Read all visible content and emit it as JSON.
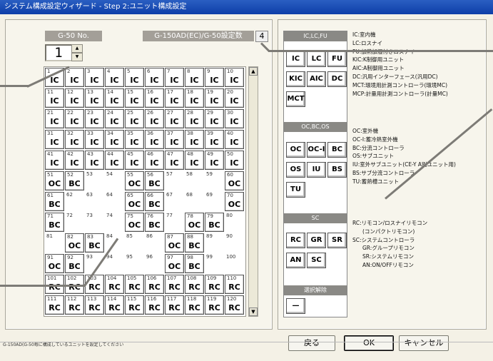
{
  "window": {
    "title": "システム構成設定ウィザード - Step 2:ユニット構成設定"
  },
  "left": {
    "g50_label": "G-50 No.",
    "g50_value": "1",
    "count_label": "G-150AD(EC)/G-50設定数",
    "count_value": "4"
  },
  "grid": {
    "cells": [
      {
        "n": "1",
        "c": "IC"
      },
      {
        "n": "2",
        "c": "IC"
      },
      {
        "n": "3",
        "c": "IC"
      },
      {
        "n": "4",
        "c": "IC"
      },
      {
        "n": "5",
        "c": "IC"
      },
      {
        "n": "6",
        "c": "IC"
      },
      {
        "n": "7",
        "c": "IC"
      },
      {
        "n": "8",
        "c": "IC"
      },
      {
        "n": "9",
        "c": "IC"
      },
      {
        "n": "10",
        "c": "IC"
      },
      {
        "n": "11",
        "c": "IC"
      },
      {
        "n": "12",
        "c": "IC"
      },
      {
        "n": "13",
        "c": "IC"
      },
      {
        "n": "14",
        "c": "IC"
      },
      {
        "n": "15",
        "c": "IC"
      },
      {
        "n": "16",
        "c": "IC"
      },
      {
        "n": "17",
        "c": "IC"
      },
      {
        "n": "18",
        "c": "IC"
      },
      {
        "n": "19",
        "c": "IC"
      },
      {
        "n": "20",
        "c": "IC"
      },
      {
        "n": "21",
        "c": "IC"
      },
      {
        "n": "22",
        "c": "IC"
      },
      {
        "n": "23",
        "c": "IC"
      },
      {
        "n": "24",
        "c": "IC"
      },
      {
        "n": "25",
        "c": "IC"
      },
      {
        "n": "26",
        "c": "IC"
      },
      {
        "n": "27",
        "c": "IC"
      },
      {
        "n": "28",
        "c": "IC"
      },
      {
        "n": "29",
        "c": "IC"
      },
      {
        "n": "30",
        "c": "IC"
      },
      {
        "n": "31",
        "c": "IC"
      },
      {
        "n": "32",
        "c": "IC"
      },
      {
        "n": "33",
        "c": "IC"
      },
      {
        "n": "34",
        "c": "IC"
      },
      {
        "n": "35",
        "c": "IC"
      },
      {
        "n": "36",
        "c": "IC"
      },
      {
        "n": "37",
        "c": "IC"
      },
      {
        "n": "38",
        "c": "IC"
      },
      {
        "n": "39",
        "c": "IC"
      },
      {
        "n": "40",
        "c": "IC"
      },
      {
        "n": "41",
        "c": "IC"
      },
      {
        "n": "42",
        "c": "IC"
      },
      {
        "n": "43",
        "c": "IC"
      },
      {
        "n": "44",
        "c": "IC"
      },
      {
        "n": "45",
        "c": "IC"
      },
      {
        "n": "46",
        "c": "IC"
      },
      {
        "n": "47",
        "c": "IC"
      },
      {
        "n": "48",
        "c": "IC"
      },
      {
        "n": "49",
        "c": "IC"
      },
      {
        "n": "50",
        "c": "IC"
      },
      {
        "n": "51",
        "c": "OC"
      },
      {
        "n": "52",
        "c": "BC"
      },
      {
        "n": "53",
        "c": ""
      },
      {
        "n": "54",
        "c": ""
      },
      {
        "n": "55",
        "c": "OC"
      },
      {
        "n": "56",
        "c": "BC"
      },
      {
        "n": "57",
        "c": ""
      },
      {
        "n": "58",
        "c": ""
      },
      {
        "n": "59",
        "c": ""
      },
      {
        "n": "60",
        "c": "OC"
      },
      {
        "n": "61",
        "c": "BC"
      },
      {
        "n": "62",
        "c": ""
      },
      {
        "n": "63",
        "c": ""
      },
      {
        "n": "64",
        "c": ""
      },
      {
        "n": "65",
        "c": "OC"
      },
      {
        "n": "66",
        "c": "BC"
      },
      {
        "n": "67",
        "c": ""
      },
      {
        "n": "68",
        "c": ""
      },
      {
        "n": "69",
        "c": ""
      },
      {
        "n": "70",
        "c": "OC"
      },
      {
        "n": "71",
        "c": "BC"
      },
      {
        "n": "72",
        "c": ""
      },
      {
        "n": "73",
        "c": ""
      },
      {
        "n": "74",
        "c": ""
      },
      {
        "n": "75",
        "c": "OC"
      },
      {
        "n": "76",
        "c": "BC"
      },
      {
        "n": "77",
        "c": ""
      },
      {
        "n": "78",
        "c": "OC"
      },
      {
        "n": "79",
        "c": "BC"
      },
      {
        "n": "80",
        "c": ""
      },
      {
        "n": "81",
        "c": ""
      },
      {
        "n": "82",
        "c": "OC"
      },
      {
        "n": "83",
        "c": "BC"
      },
      {
        "n": "84",
        "c": ""
      },
      {
        "n": "85",
        "c": ""
      },
      {
        "n": "86",
        "c": ""
      },
      {
        "n": "87",
        "c": "OC"
      },
      {
        "n": "88",
        "c": "BC"
      },
      {
        "n": "89",
        "c": ""
      },
      {
        "n": "90",
        "c": ""
      },
      {
        "n": "91",
        "c": "OC"
      },
      {
        "n": "92",
        "c": "BC"
      },
      {
        "n": "93",
        "c": ""
      },
      {
        "n": "94",
        "c": ""
      },
      {
        "n": "95",
        "c": ""
      },
      {
        "n": "96",
        "c": ""
      },
      {
        "n": "97",
        "c": "OC"
      },
      {
        "n": "98",
        "c": "BC"
      },
      {
        "n": "99",
        "c": ""
      },
      {
        "n": "100",
        "c": ""
      },
      {
        "n": "101",
        "c": "RC"
      },
      {
        "n": "102",
        "c": "RC"
      },
      {
        "n": "103",
        "c": "RC"
      },
      {
        "n": "104",
        "c": "RC"
      },
      {
        "n": "105",
        "c": "RC"
      },
      {
        "n": "106",
        "c": "RC"
      },
      {
        "n": "107",
        "c": "RC"
      },
      {
        "n": "108",
        "c": "RC"
      },
      {
        "n": "109",
        "c": "RC"
      },
      {
        "n": "110",
        "c": "RC"
      },
      {
        "n": "111",
        "c": "RC"
      },
      {
        "n": "112",
        "c": "RC"
      },
      {
        "n": "113",
        "c": "RC"
      },
      {
        "n": "114",
        "c": "RC"
      },
      {
        "n": "115",
        "c": "RC"
      },
      {
        "n": "116",
        "c": "RC"
      },
      {
        "n": "117",
        "c": "RC"
      },
      {
        "n": "118",
        "c": "RC"
      },
      {
        "n": "119",
        "c": "RC"
      },
      {
        "n": "120",
        "c": "RC"
      }
    ]
  },
  "palette": {
    "group1_header": "IC,LC,FU",
    "group1": [
      "IC",
      "LC",
      "FU",
      "KIC",
      "AIC",
      "DC",
      "MCT"
    ],
    "group2_header": "OC,BC,OS",
    "group2": [
      "OC",
      "OC-I",
      "BC",
      "OS",
      "IU",
      "BS",
      "TU"
    ],
    "group3_header": "SC",
    "group3": [
      "RC",
      "GR",
      "SR",
      "AN",
      "SC"
    ],
    "group4_header": "選択解除",
    "clear_label": "—"
  },
  "legend": {
    "group1": [
      "IC:室内機",
      "LC:ロスナイ",
      "FU:加熱加湿付きロスナイ",
      "KIC:K制御用ユニット",
      "AIC:A制御用ユニット",
      "DC:汎用インターフェース(汎用DC)",
      "MCT:環境用計測コントローラ(環境MC)",
      "MCP:計量用計測コントローラ(計量MC)"
    ],
    "group2": [
      "OC:室外機",
      "OC-I:蓄冷熱室外機",
      "BC:分流コントローラ",
      "OS:サブユニット",
      "IU:室外サブユニット(CE-Y A別ユニット用)",
      "BS:サブ分流コントローラ",
      "TU:蓄熱槽ユニット"
    ],
    "group3": [
      "RC:リモコン/ロスナイリモコン",
      "(コンパクトリモコン)",
      "SC:システムコントローラ",
      "GR:グループリモコン",
      "SR:システムリモコン",
      "AN:ON/OFFリモコン"
    ]
  },
  "buttons": {
    "back": "戻る",
    "ok": "OK",
    "cancel": "キャンセル"
  },
  "status": "G-150AD(G-50毎に構成しているユニットを設定してください"
}
